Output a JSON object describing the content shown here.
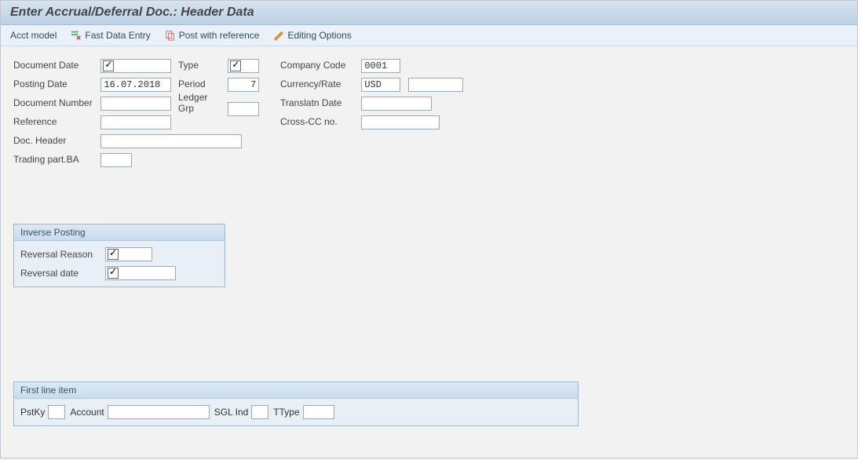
{
  "header": {
    "title": "Enter Accrual/Deferral Doc.: Header Data"
  },
  "toolbar": {
    "acct_model": "Acct model",
    "fast_data_entry": "Fast Data Entry",
    "post_with_reference": "Post with reference",
    "editing_options": "Editing Options"
  },
  "fields": {
    "document_date": {
      "label": "Document Date",
      "value": ""
    },
    "posting_date": {
      "label": "Posting Date",
      "value": "16.07.2018"
    },
    "document_number": {
      "label": "Document Number",
      "value": ""
    },
    "reference": {
      "label": "Reference",
      "value": ""
    },
    "doc_header": {
      "label": "Doc. Header",
      "value": ""
    },
    "trading_part_ba": {
      "label": "Trading part.BA",
      "value": ""
    },
    "type": {
      "label": "Type",
      "value": ""
    },
    "period": {
      "label": "Period",
      "value": "7"
    },
    "ledger_grp": {
      "label": "Ledger Grp",
      "value": ""
    },
    "company_code": {
      "label": "Company Code",
      "value": "0001"
    },
    "currency_rate": {
      "label": "Currency/Rate",
      "value": "USD",
      "value2": ""
    },
    "translatn_date": {
      "label": "Translatn Date",
      "value": ""
    },
    "cross_cc_no": {
      "label": "Cross-CC no.",
      "value": ""
    }
  },
  "inverse_posting": {
    "title": "Inverse Posting",
    "reversal_reason": {
      "label": "Reversal Reason",
      "value": ""
    },
    "reversal_date": {
      "label": "Reversal date",
      "value": ""
    }
  },
  "first_line_item": {
    "title": "First line item",
    "pstky": {
      "label": "PstKy",
      "value": ""
    },
    "account": {
      "label": "Account",
      "value": ""
    },
    "sgl_ind": {
      "label": "SGL Ind",
      "value": ""
    },
    "ttype": {
      "label": "TType",
      "value": ""
    }
  }
}
